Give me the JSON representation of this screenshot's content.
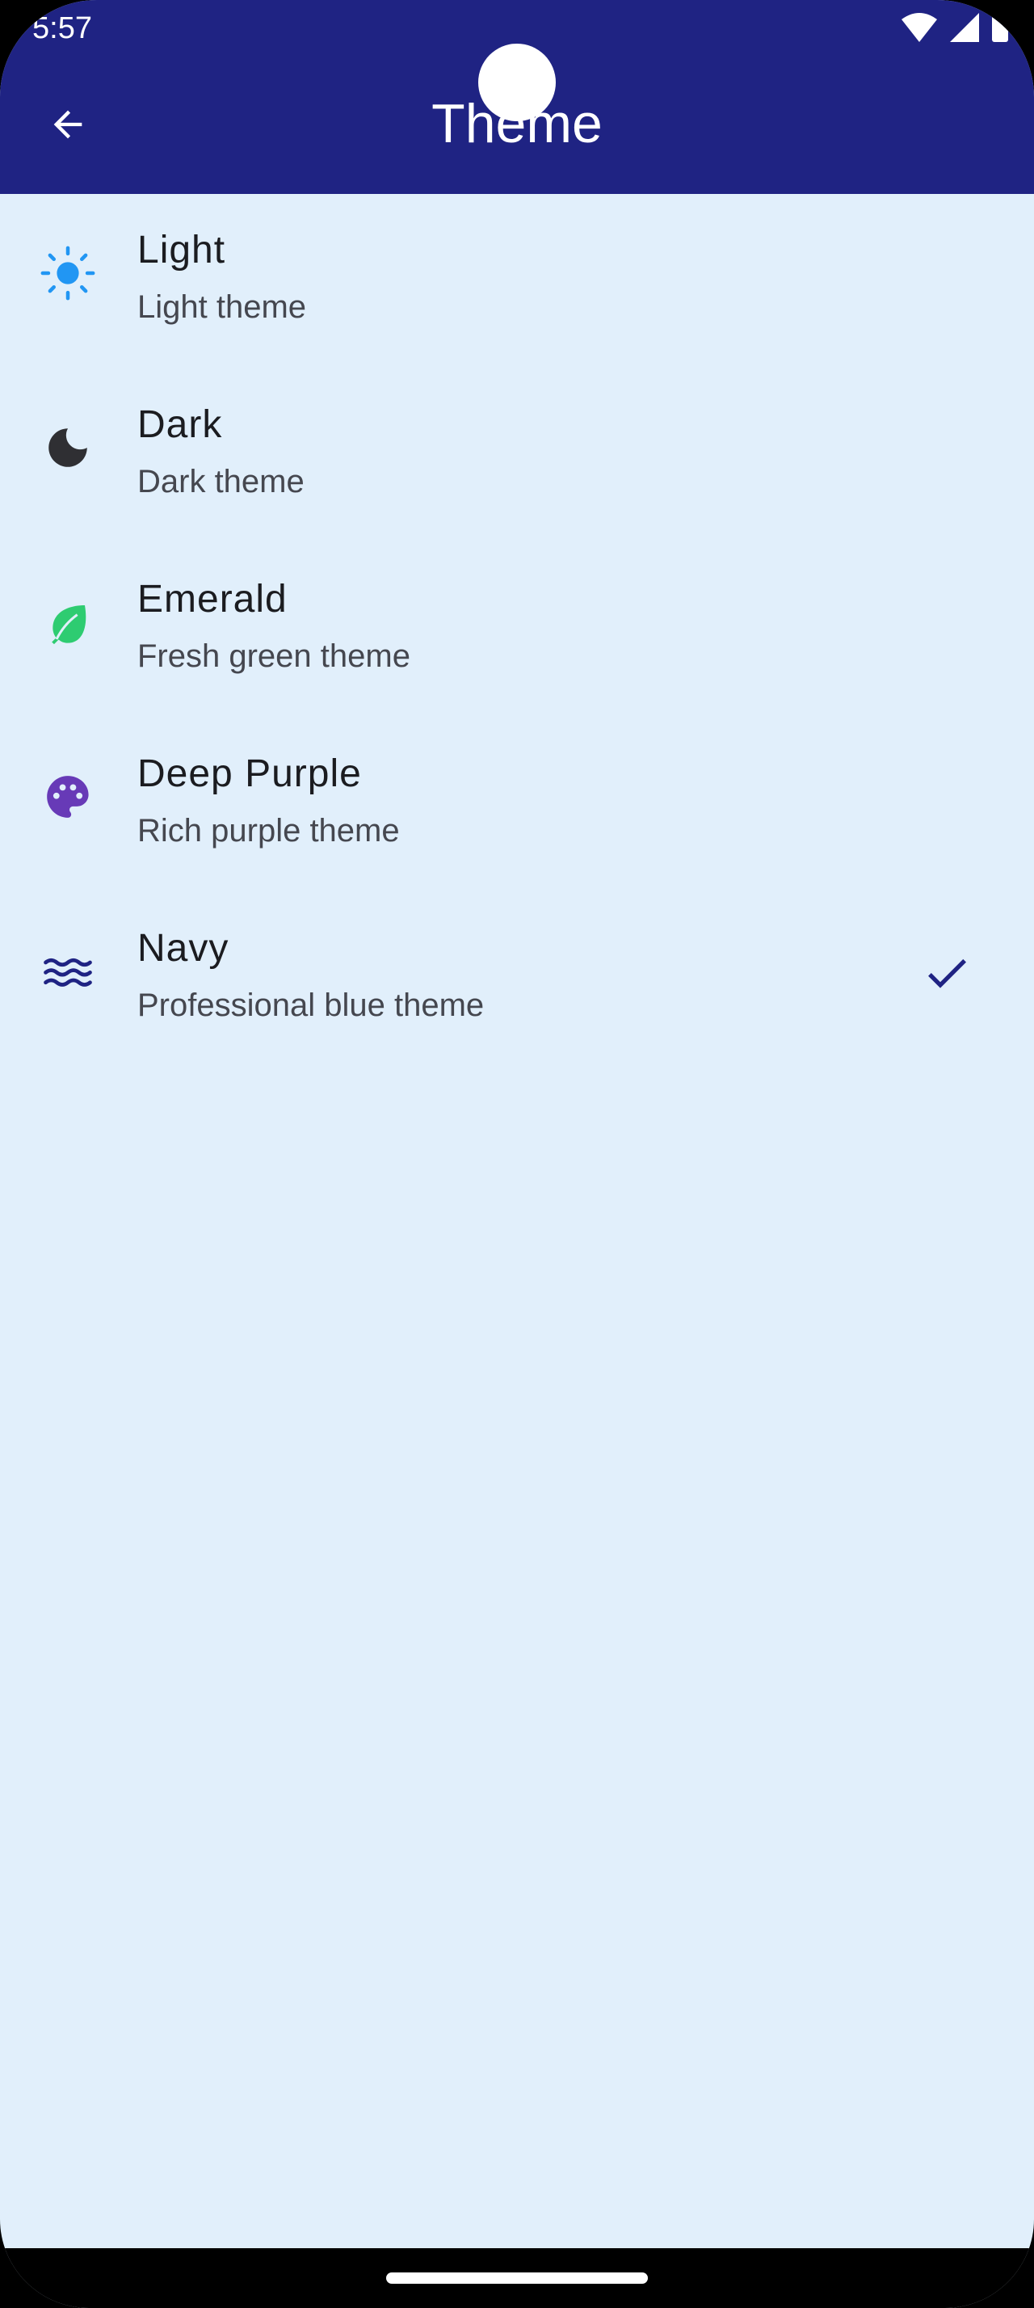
{
  "status_bar": {
    "time": "5:57"
  },
  "app_bar": {
    "title": "Theme"
  },
  "themes": [
    {
      "label": "Light",
      "description": "Light theme",
      "icon": "sun-icon",
      "color": "#2196f3",
      "selected": false
    },
    {
      "label": "Dark",
      "description": "Dark theme",
      "icon": "moon-icon",
      "color": "#2f2f33",
      "selected": false
    },
    {
      "label": "Emerald",
      "description": "Fresh green theme",
      "icon": "leaf-icon",
      "color": "#2ecc71",
      "selected": false
    },
    {
      "label": "Deep Purple",
      "description": "Rich purple theme",
      "icon": "palette-icon",
      "color": "#673ab7",
      "selected": false
    },
    {
      "label": "Navy",
      "description": "Professional blue theme",
      "icon": "waves-icon",
      "color": "#1f2383",
      "selected": true
    }
  ],
  "colors": {
    "app_bar": "#1f2383",
    "background": "#e1effb",
    "check": "#1f2383"
  }
}
